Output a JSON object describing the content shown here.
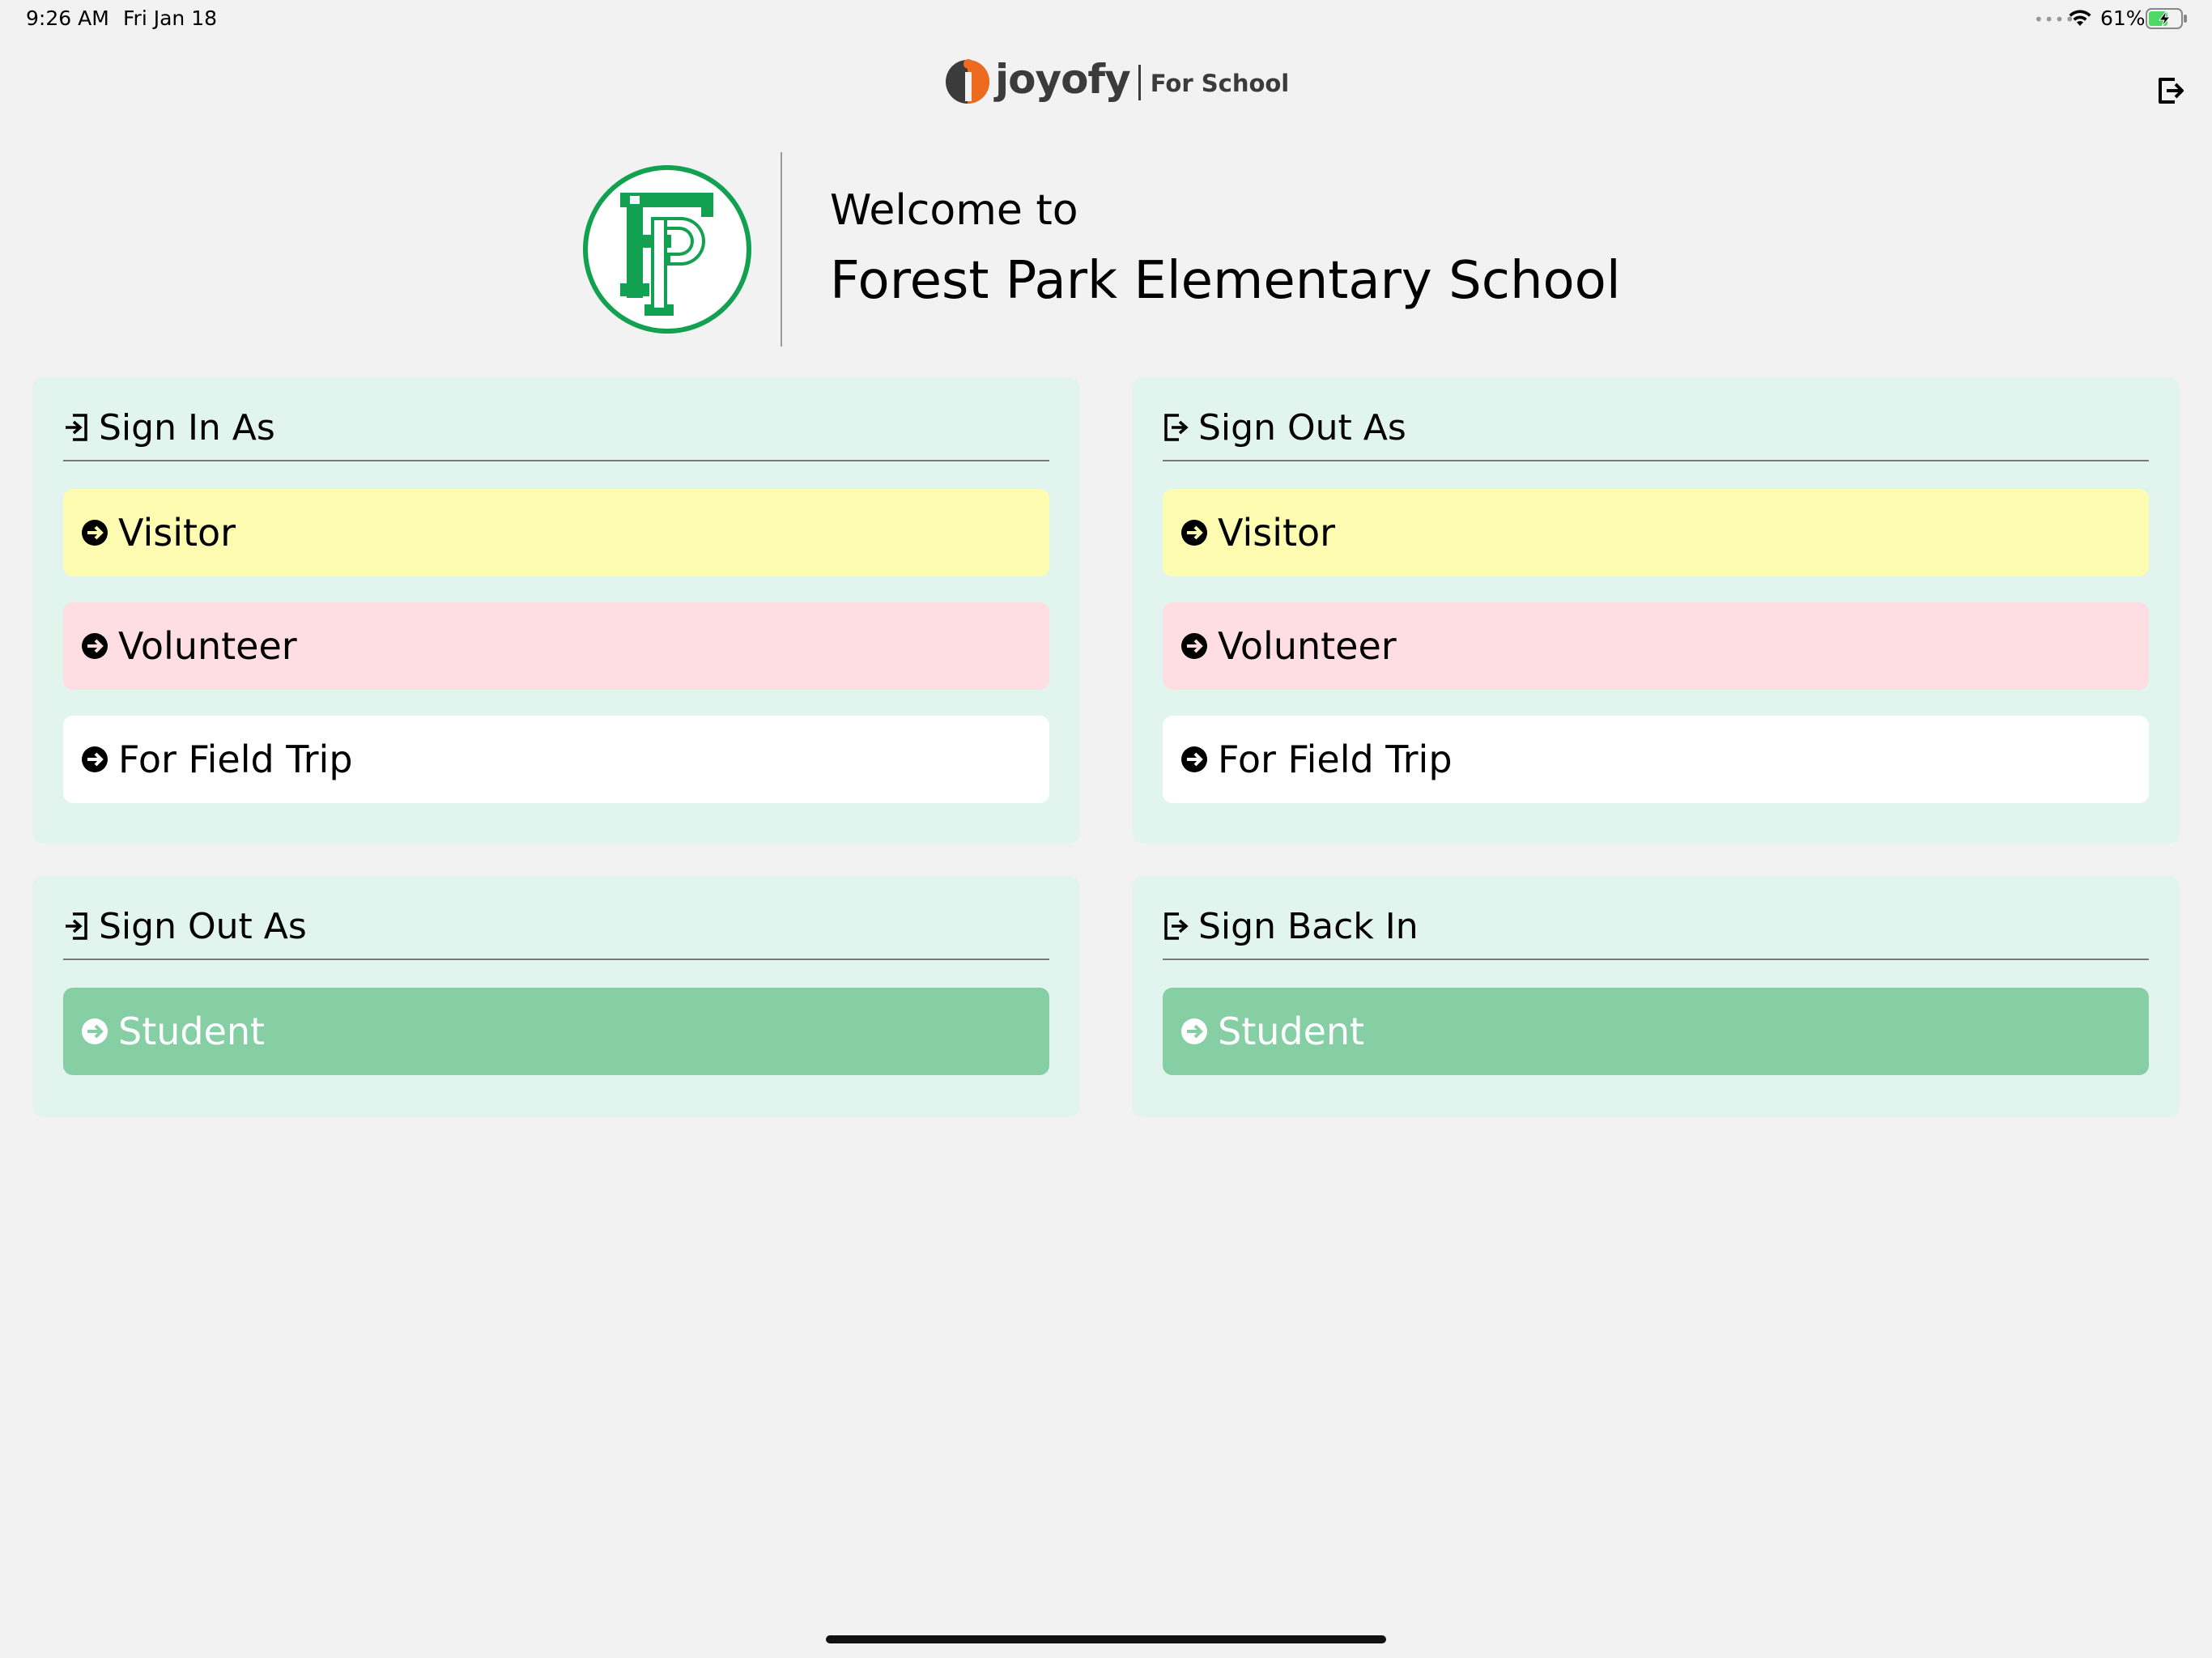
{
  "status_bar": {
    "time": "9:26 AM",
    "date": "Fri Jan 18",
    "battery_percent": "61%",
    "battery_level": 0.61,
    "icons": [
      "wifi-icon",
      "battery-charging-icon"
    ]
  },
  "header": {
    "brand": "joyofy",
    "brand_suffix": "For School",
    "exit_icon": "sign-out-icon"
  },
  "welcome": {
    "label": "Welcome to",
    "school_name": "Forest Park Elementary School",
    "seal_letters": "FP"
  },
  "panels": [
    {
      "title": "Sign In As",
      "icon": "sign-in-icon",
      "options": [
        {
          "label": "Visitor",
          "color": "#fefcb0"
        },
        {
          "label": "Volunteer",
          "color": "#fedde3"
        },
        {
          "label": "For Field Trip",
          "color": "#ffffff"
        }
      ]
    },
    {
      "title": "Sign Out As",
      "icon": "sign-out-icon",
      "options": [
        {
          "label": "Visitor",
          "color": "#fefcb0"
        },
        {
          "label": "Volunteer",
          "color": "#fedde3"
        },
        {
          "label": "For Field Trip",
          "color": "#ffffff"
        }
      ]
    },
    {
      "title": "Sign Out As",
      "icon": "sign-in-icon",
      "options": [
        {
          "label": "Student",
          "color": "#86cfa5"
        }
      ]
    },
    {
      "title": "Sign Back In",
      "icon": "sign-out-icon",
      "options": [
        {
          "label": "Student",
          "color": "#86cfa5"
        }
      ]
    }
  ],
  "colors": {
    "background": "#f2f2f2",
    "panel": "#e1f4ee",
    "seal_green": "#12a150",
    "brand_orange": "#ee6a1f"
  }
}
